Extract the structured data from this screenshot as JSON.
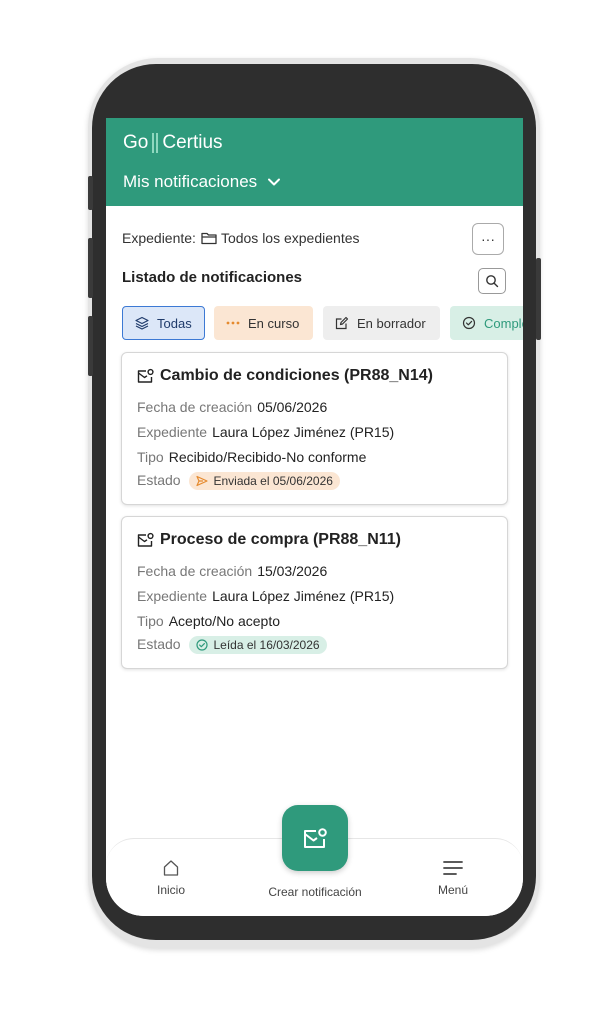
{
  "header": {
    "logo_left": "Go",
    "logo_right": "Certius",
    "title": "Mis notificaciones"
  },
  "expediente": {
    "label": "Expediente:",
    "value": "Todos los expedientes"
  },
  "more_label": "···",
  "list": {
    "title": "Listado de notificaciones"
  },
  "filters": [
    {
      "label": "Todas"
    },
    {
      "label": "En curso"
    },
    {
      "label": "En borrador"
    },
    {
      "label": "Completada"
    }
  ],
  "cards": [
    {
      "title": "Cambio de condiciones (PR88_N14)",
      "fecha_label": "Fecha de creación",
      "fecha": "05/06/2026",
      "expediente_label": "Expediente",
      "expediente": "Laura López Jiménez (PR15)",
      "tipo_label": "Tipo",
      "tipo": "Recibido/Recibido-No conforme",
      "estado_label": "Estado",
      "estado": "Enviada el 05/06/2026"
    },
    {
      "title": "Proceso de compra (PR88_N11)",
      "fecha_label": "Fecha de creación",
      "fecha": "15/03/2026",
      "expediente_label": "Expediente",
      "expediente": "Laura López Jiménez (PR15)",
      "tipo_label": "Tipo",
      "tipo": "Acepto/No acepto",
      "estado_label": "Estado",
      "estado": "Leída el 16/03/2026"
    }
  ],
  "nav": {
    "inicio": "Inicio",
    "crear": "Crear notificación",
    "menu": "Menú"
  },
  "colors": {
    "brand": "#2f9a7c",
    "accent_blue": "#3c79d4",
    "in_progress": "#fbe6d3",
    "done": "#d8efe6"
  }
}
